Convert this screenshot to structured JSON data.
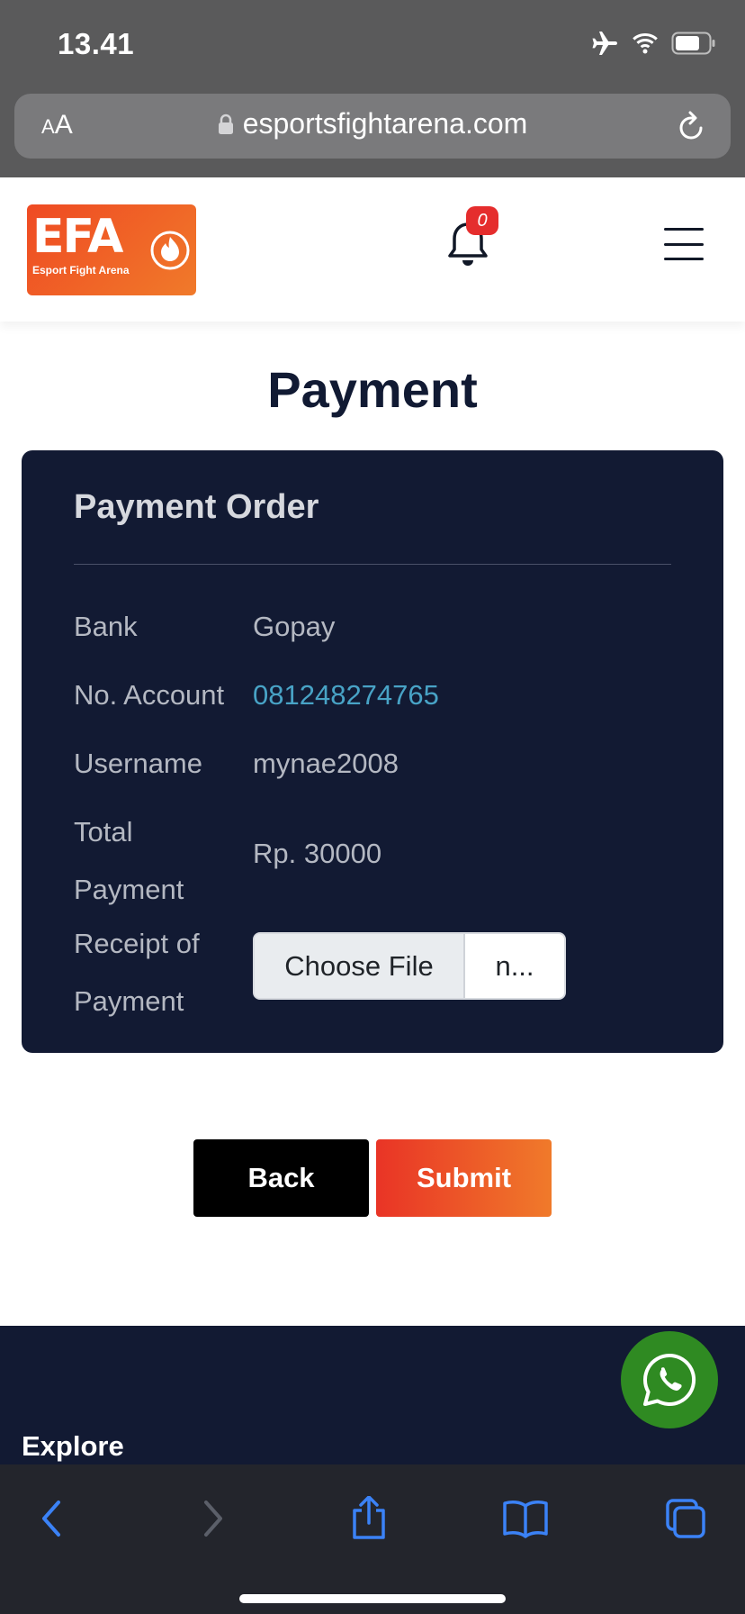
{
  "status_bar": {
    "time": "13.41",
    "icons": [
      "airplane-icon",
      "wifi-icon",
      "battery-icon"
    ]
  },
  "browser": {
    "text_size_button": {
      "small": "A",
      "large": "A"
    },
    "url": "esportsfightarena.com",
    "icons": [
      "lock-icon",
      "reload-icon"
    ]
  },
  "header": {
    "logo": {
      "big": "EFA",
      "small": "Esport Fight Arena"
    },
    "notification_count": "0"
  },
  "page": {
    "title": "Payment"
  },
  "payment_order": {
    "title": "Payment Order",
    "rows": [
      {
        "label": "Bank",
        "value": "Gopay"
      },
      {
        "label": "No. Account",
        "value": "081248274765"
      },
      {
        "label": "Username",
        "value": "mynae2008"
      },
      {
        "label": "Total Payment",
        "value": "Rp. 30000"
      }
    ],
    "receipt_label": "Receipt of Payment",
    "file_button": "Choose File",
    "file_name": "n..."
  },
  "actions": {
    "back": "Back",
    "submit": "Submit"
  },
  "footer": {
    "explore": "Explore"
  },
  "colors": {
    "accent": "#ef4a23",
    "card_bg": "#121a33",
    "link": "#48a3c6",
    "whatsapp": "#2f8a22"
  },
  "toolbar": {
    "icons": [
      "back-icon",
      "forward-icon",
      "share-icon",
      "bookmarks-icon",
      "tabs-icon"
    ]
  }
}
